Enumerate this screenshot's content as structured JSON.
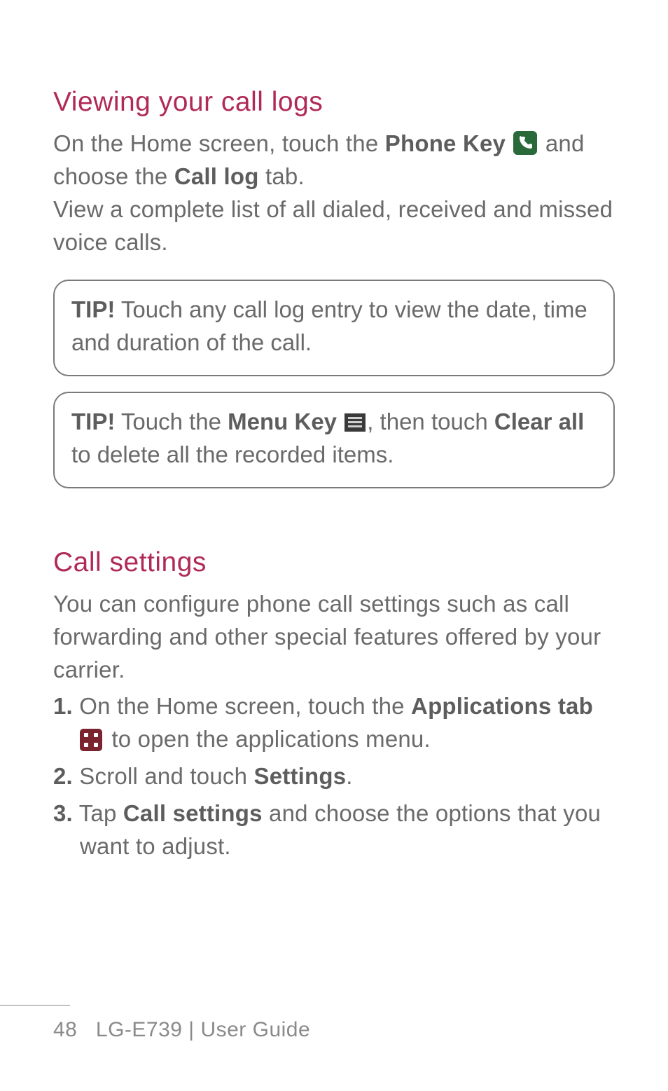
{
  "section1": {
    "heading": "Viewing your call logs",
    "p1_a": "On the Home screen, touch the ",
    "p1_b_bold": "Phone Key",
    "p1_c": " and choose the ",
    "p1_d_bold": "Call log",
    "p1_e": " tab.",
    "p2": "View a complete list of all dialed, received and missed voice calls."
  },
  "tip1": {
    "label": "TIP!",
    "text": " Touch any call log entry to view the date, time and duration of the call."
  },
  "tip2": {
    "label": "TIP!",
    "a": " Touch the ",
    "b_bold": "Menu Key",
    "c": ", then touch ",
    "d_bold": "Clear all",
    "e": " to delete all the recorded items."
  },
  "section2": {
    "heading": "Call settings",
    "intro": "You can configure phone call settings such as call forwarding and other special features offered by your carrier.",
    "steps": [
      {
        "num": "1.",
        "a": "  On the Home screen, touch the ",
        "b_bold": "Applications tab",
        "c": " to open the applications menu."
      },
      {
        "num": "2.",
        "a": " Scroll and touch ",
        "b_bold": "Settings",
        "c": "."
      },
      {
        "num": "3.",
        "a": " Tap ",
        "b_bold": "Call settings",
        "c": " and choose the options that you want to adjust."
      }
    ]
  },
  "footer": {
    "page": "48",
    "model": "LG-E739",
    "divider": "  |  ",
    "doc": "User Guide"
  }
}
